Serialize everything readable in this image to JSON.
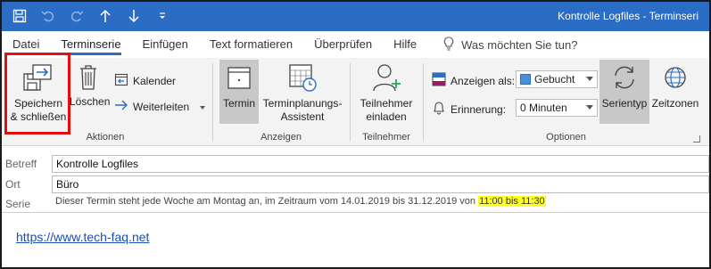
{
  "window": {
    "title": "Kontrolle Logfiles  -  Terminseri"
  },
  "tabs": [
    {
      "label": "Datei",
      "active": false
    },
    {
      "label": "Terminserie",
      "active": true
    },
    {
      "label": "Einfügen",
      "active": false
    },
    {
      "label": "Text formatieren",
      "active": false
    },
    {
      "label": "Überprüfen",
      "active": false
    },
    {
      "label": "Hilfe",
      "active": false
    }
  ],
  "search": {
    "label": "Was möchten Sie tun?"
  },
  "ribbon": {
    "actions": {
      "save_line1": "Speichern",
      "save_line2": "& schließen",
      "delete_label": "Löschen",
      "calendar_label": "Kalender",
      "forward_label": "Weiterleiten",
      "group_label": "Aktionen"
    },
    "show": {
      "appointment_label": "Termin",
      "assistant_line1": "Terminplanungs-",
      "assistant_line2": "Assistent",
      "group_label": "Anzeigen"
    },
    "participants": {
      "invite_line1": "Teilnehmer",
      "invite_line2": "einladen",
      "group_label": "Teilnehmer"
    },
    "options": {
      "show_as_label": "Anzeigen als:",
      "show_as_value": "Gebucht",
      "reminder_label": "Erinnerung:",
      "reminder_value": "0 Minuten",
      "recurrence_label": "Serientyp",
      "timezones_label": "Zeitzonen",
      "group_label": "Optionen"
    }
  },
  "form": {
    "subject_label": "Betreff",
    "subject_value": "Kontrolle Logfiles",
    "location_label": "Ort",
    "location_value": "Büro",
    "series_label": "Serie",
    "series_text": "Dieser Termin steht jede Woche am Montag an, im Zeitraum vom 14.01.2019 bis 31.12.2019 von",
    "series_time": "11:00 bis 11:30",
    "body_link": "https://www.tech-faq.net"
  },
  "colors": {
    "titlebar": "#2b6cc4",
    "accent": "#2b6cc4",
    "highlight_box": "#e01010",
    "time_highlight": "#ffff22",
    "busy_blue": "#4a90d9"
  }
}
